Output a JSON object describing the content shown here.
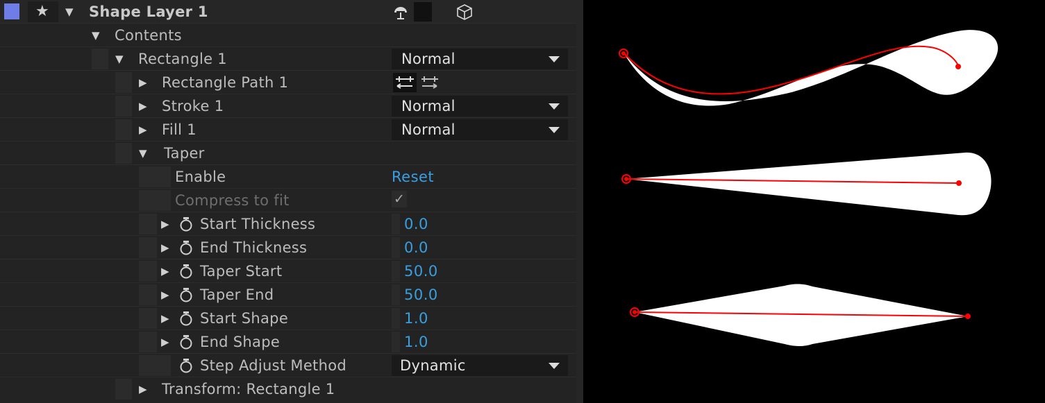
{
  "layer": {
    "name": "Shape Layer 1",
    "label_color": "#6f7ee6"
  },
  "rows": {
    "contents": "Contents",
    "rectangle": {
      "label": "Rectangle 1",
      "blend_mode": "Normal"
    },
    "rect_path": "Rectangle Path 1",
    "stroke": {
      "label": "Stroke 1",
      "blend_mode": "Normal"
    },
    "fill": {
      "label": "Fill 1",
      "blend_mode": "Normal"
    },
    "taper": "Taper",
    "enable": {
      "label": "Enable",
      "reset": "Reset"
    },
    "compress": {
      "label": "Compress to fit",
      "checked": "✓"
    },
    "start_thickness": {
      "label": "Start Thickness",
      "value": "0.0"
    },
    "end_thickness": {
      "label": "End Thickness",
      "value": "0.0"
    },
    "taper_start": {
      "label": "Taper Start",
      "value": "50.0"
    },
    "taper_end": {
      "label": "Taper End",
      "value": "50.0"
    },
    "start_shape": {
      "label": "Start Shape",
      "value": "1.0"
    },
    "end_shape": {
      "label": "End Shape",
      "value": "1.0"
    },
    "step_adjust": {
      "label": "Step Adjust Method",
      "value": "Dynamic"
    },
    "transform": "Transform: Rectangle 1"
  },
  "icons": {
    "star": "star-icon",
    "twirl": "triangle-icon",
    "stopwatch": "stopwatch-icon",
    "motion_blur": "motion-blur-icon",
    "cube": "3d-layer-icon",
    "path_direction": "reverse-path-icon"
  },
  "colors": {
    "accent_blue": "#3a9fe0",
    "path_red": "#ff0000",
    "shape_white": "#ffffff"
  }
}
